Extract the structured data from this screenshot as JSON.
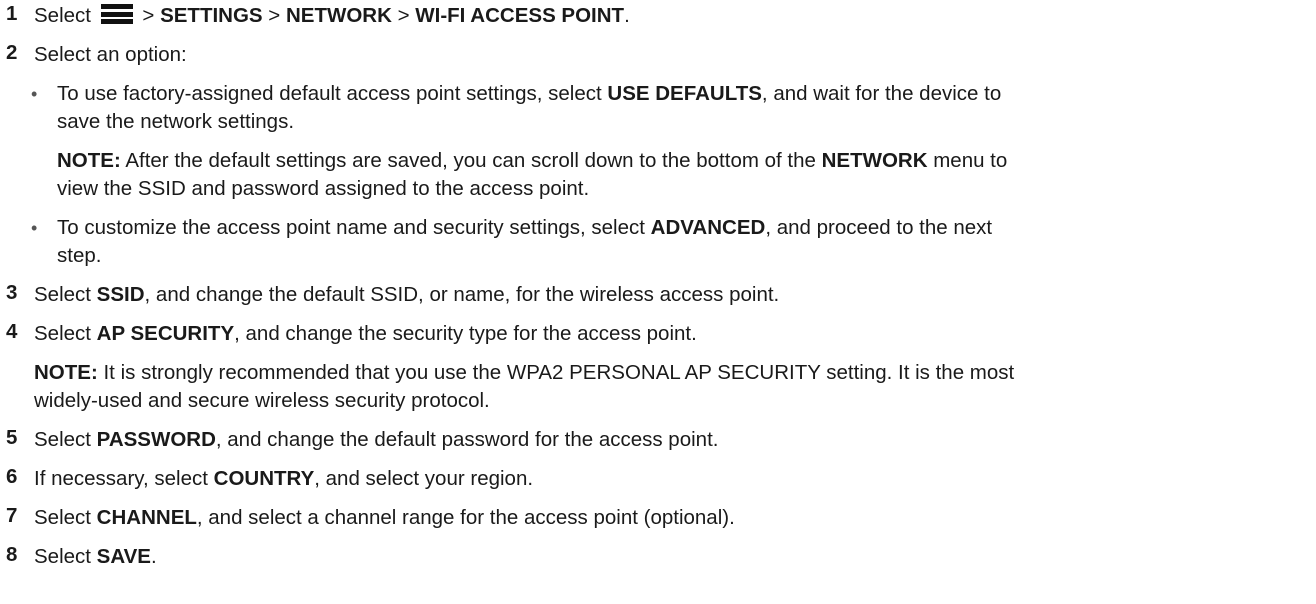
{
  "steps": {
    "s1": {
      "num": "1",
      "a": "Select",
      "sep": ">",
      "b1": "SETTINGS",
      "b2": "NETWORK",
      "b3": "WI-FI ACCESS POINT",
      "end": "."
    },
    "s2": {
      "num": "2",
      "text": "Select an option:"
    },
    "bullet_char": "•",
    "opt1": {
      "l1a": "To use factory-assigned default access point settings, select ",
      "l1b": "USE DEFAULTS",
      "l1c": ", and wait for the device to",
      "l2": "save the network settings."
    },
    "note1": {
      "label": "NOTE:",
      "l1a": " After the default settings are saved, you can scroll down to the bottom of the ",
      "l1b": "NETWORK",
      "l1c": " menu to",
      "l2": "view the SSID and password assigned to the access point."
    },
    "opt2": {
      "l1a": "To customize the access point name and security settings, select ",
      "l1b": "ADVANCED",
      "l1c": ", and proceed to the next",
      "l2": "step."
    },
    "s3": {
      "num": "3",
      "a": "Select ",
      "b": "SSID",
      "c": ", and change the default SSID, or name, for the wireless access point."
    },
    "s4": {
      "num": "4",
      "a": "Select ",
      "b": "AP SECURITY",
      "c": ", and change the security type for the access point."
    },
    "note2": {
      "label": "NOTE:",
      "l1": " It is strongly recommended that you use the WPA2 PERSONAL AP SECURITY setting. It is the most",
      "l2": "widely-used and secure wireless security protocol."
    },
    "s5": {
      "num": "5",
      "a": "Select ",
      "b": "PASSWORD",
      "c": ", and change the default password for the access point."
    },
    "s6": {
      "num": "6",
      "a": "If necessary, select ",
      "b": "COUNTRY",
      "c": ", and select your region."
    },
    "s7": {
      "num": "7",
      "a": "Select ",
      "b": "CHANNEL",
      "c": ", and select a channel range for the access point (optional)."
    },
    "s8": {
      "num": "8",
      "a": "Select ",
      "b": "SAVE",
      "c": "."
    }
  }
}
